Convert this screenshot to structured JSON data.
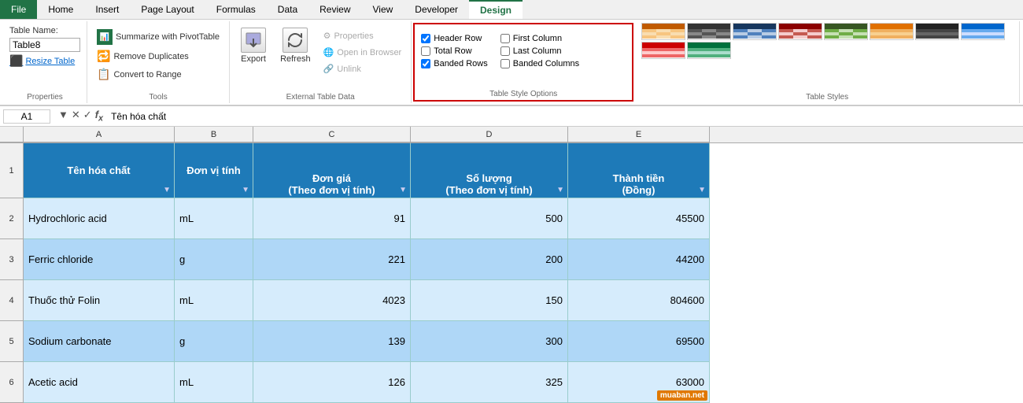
{
  "tabs": [
    {
      "label": "File",
      "id": "file",
      "active": false,
      "file": true
    },
    {
      "label": "Home",
      "id": "home",
      "active": false
    },
    {
      "label": "Insert",
      "id": "insert",
      "active": false
    },
    {
      "label": "Page Layout",
      "id": "page-layout",
      "active": false
    },
    {
      "label": "Formulas",
      "id": "formulas",
      "active": false
    },
    {
      "label": "Data",
      "id": "data",
      "active": false
    },
    {
      "label": "Review",
      "id": "review",
      "active": false
    },
    {
      "label": "View",
      "id": "view",
      "active": false
    },
    {
      "label": "Developer",
      "id": "developer",
      "active": false
    },
    {
      "label": "Design",
      "id": "design",
      "active": true
    }
  ],
  "groups": {
    "properties": {
      "label": "Properties",
      "table_name_label": "Table Name:",
      "table_name_value": "Table8",
      "resize_label": "Resize Table"
    },
    "tools": {
      "label": "Tools",
      "buttons": [
        {
          "label": "Summarize with PivotTable"
        },
        {
          "label": "Remove Duplicates"
        },
        {
          "label": "Convert to Range"
        }
      ]
    },
    "external": {
      "label": "External Table Data",
      "export_label": "Export",
      "refresh_label": "Refresh",
      "properties_label": "Properties",
      "open_browser_label": "Open in Browser",
      "unlink_label": "Unlink"
    },
    "style_options": {
      "label": "Table Style Options",
      "options": [
        {
          "label": "Header Row",
          "checked": true,
          "col": 1
        },
        {
          "label": "Total Row",
          "checked": false,
          "col": 1
        },
        {
          "label": "Banded Rows",
          "checked": true,
          "col": 1
        },
        {
          "label": "First Column",
          "checked": false,
          "col": 2
        },
        {
          "label": "Last Column",
          "checked": false,
          "col": 2
        },
        {
          "label": "Banded Columns",
          "checked": false,
          "col": 2
        }
      ]
    },
    "table_styles": {
      "label": "Table Styles"
    }
  },
  "formula_bar": {
    "cell_ref": "A1",
    "formula": "Tên hóa chất"
  },
  "columns": [
    "A",
    "B",
    "C",
    "D",
    "E"
  ],
  "header_row": {
    "col_a": "Tên hóa chất",
    "col_b": "Đơn vị tính",
    "col_c": "Đơn giá\n(Theo đơn vị tính)",
    "col_d": "Số lượng\n(Theo đơn vị tính)",
    "col_e": "Thành tiền\n(Đồng)"
  },
  "data_rows": [
    {
      "row_num": 2,
      "col_a": "Hydrochloric acid",
      "col_b": "mL",
      "col_c": "91",
      "col_d": "500",
      "col_e": "45500"
    },
    {
      "row_num": 3,
      "col_a": "Ferric chloride",
      "col_b": "g",
      "col_c": "221",
      "col_d": "200",
      "col_e": "44200"
    },
    {
      "row_num": 4,
      "col_a": "Thuốc thử Folin",
      "col_b": "mL",
      "col_c": "4023",
      "col_d": "150",
      "col_e": "804600"
    },
    {
      "row_num": 5,
      "col_a": "Sodium carbonate",
      "col_b": "g",
      "col_c": "139",
      "col_d": "300",
      "col_e": "69500"
    },
    {
      "row_num": 6,
      "col_a": "Acetic acid",
      "col_b": "mL",
      "col_c": "126",
      "col_d": "325",
      "col_e": "63000"
    }
  ],
  "watermark": "muaban.net"
}
